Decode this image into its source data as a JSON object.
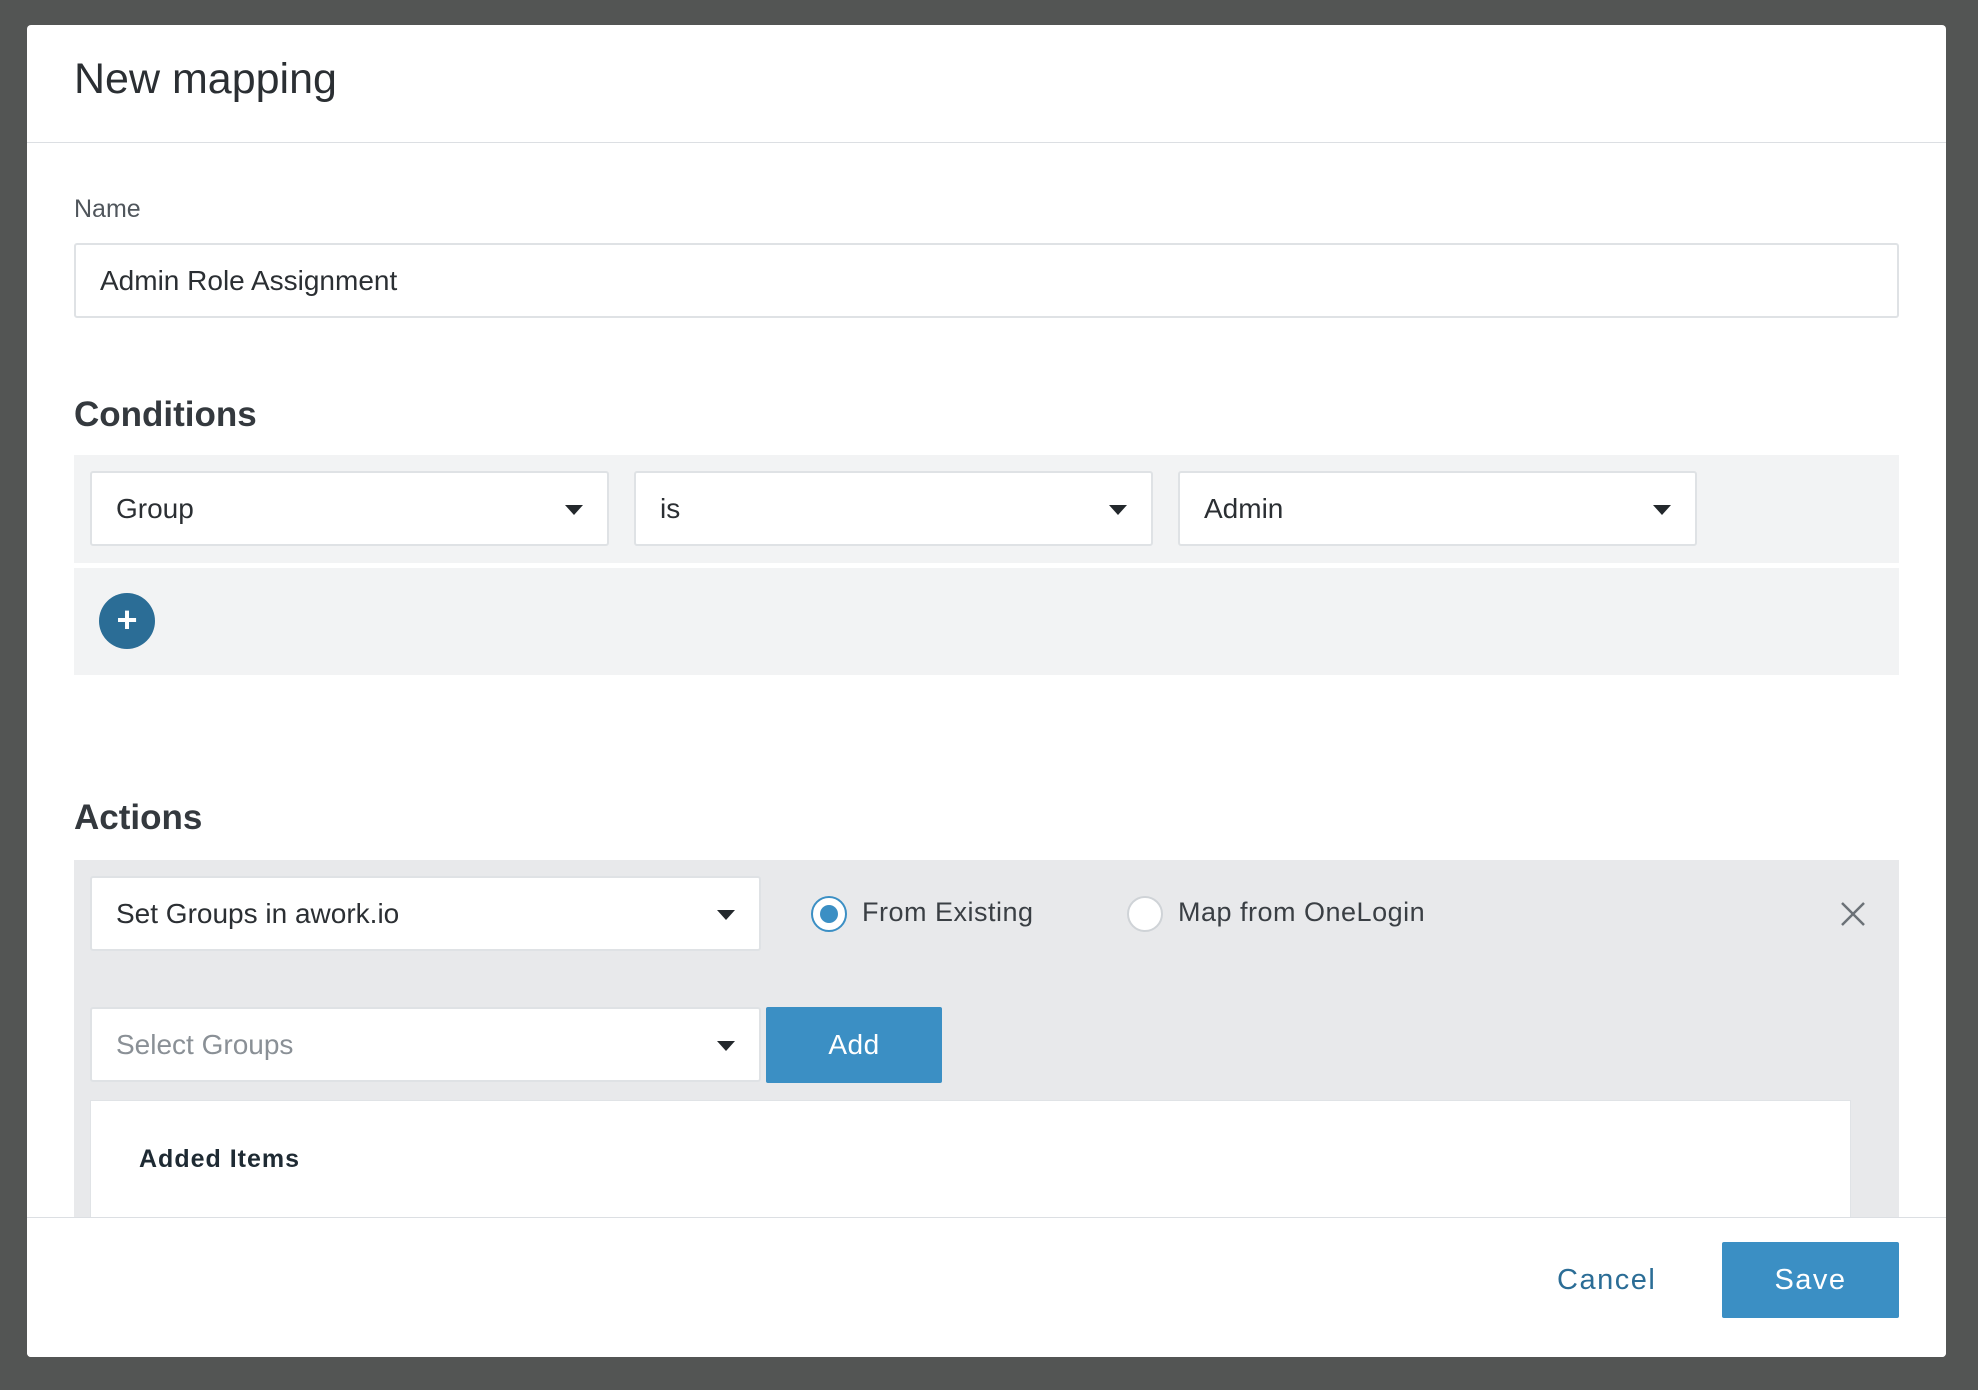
{
  "dialog": {
    "title": "New mapping"
  },
  "name_field": {
    "label": "Name",
    "value": "Admin Role Assignment"
  },
  "conditions": {
    "heading": "Conditions",
    "row": {
      "field": "Group",
      "operator": "is",
      "value": "Admin"
    },
    "add_icon": "plus-icon"
  },
  "actions": {
    "heading": "Actions",
    "action_select": "Set Groups in awork.io",
    "radio_options": [
      {
        "label": "From Existing",
        "checked": true
      },
      {
        "label": "Map from OneLogin",
        "checked": false
      }
    ],
    "remove_icon": "close-icon",
    "groups_select": {
      "placeholder": "Select Groups"
    },
    "add_label": "Add",
    "added_items_title": "Added Items"
  },
  "footer": {
    "cancel_label": "Cancel",
    "save_label": "Save"
  },
  "colors": {
    "backdrop": "#535554",
    "accent": "#3b8fc4",
    "accent_dark": "#2b6d96"
  }
}
